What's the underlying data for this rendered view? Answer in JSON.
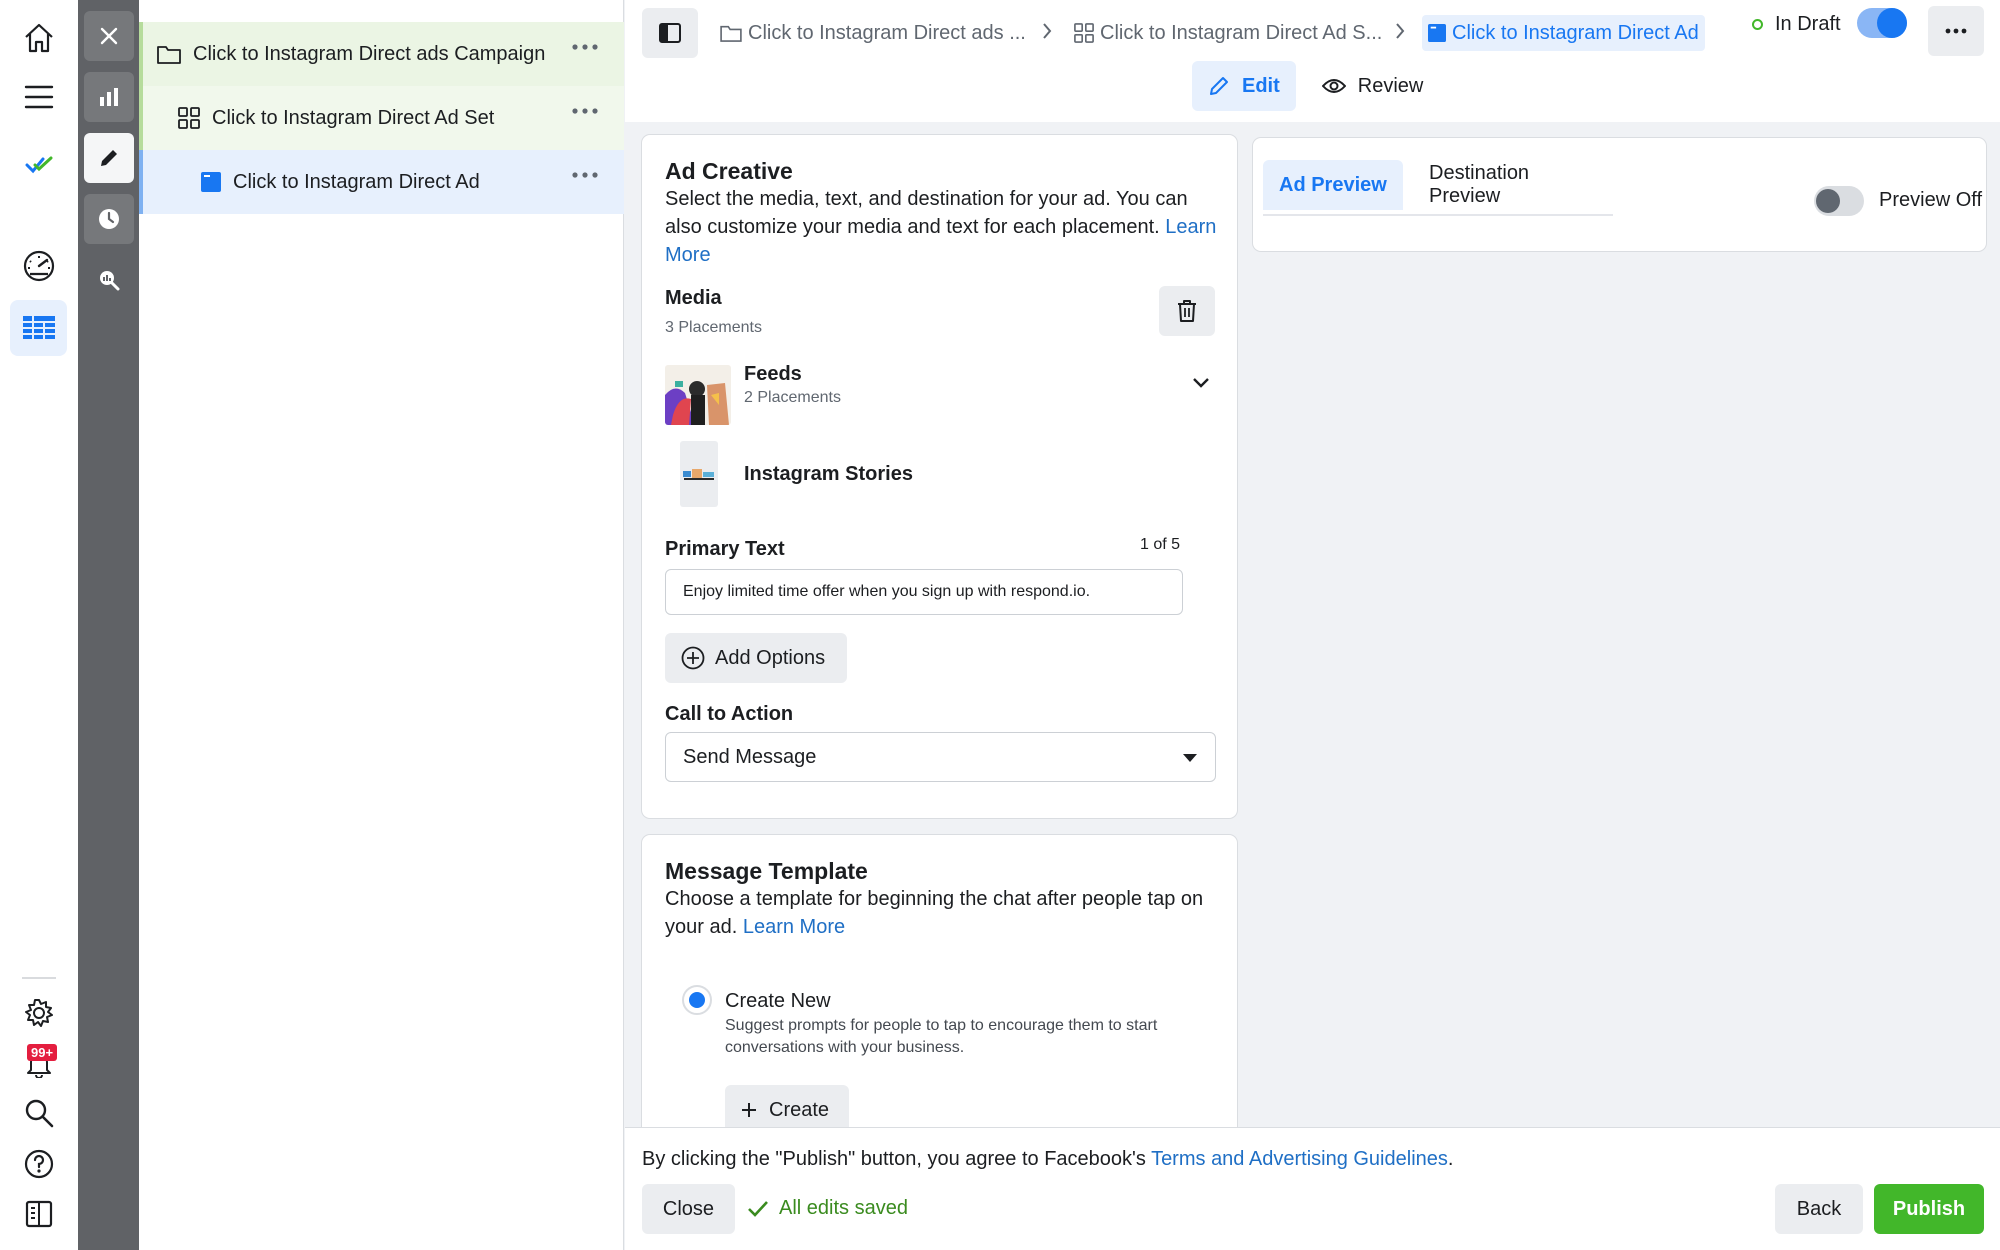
{
  "rail": {
    "notifications_badge": "99+"
  },
  "tree": {
    "campaign_label": "Click to Instagram Direct ads Campaign",
    "adset_label": "Click to Instagram Direct Ad Set",
    "ad_label": "Click to Instagram Direct Ad"
  },
  "topbar": {
    "breadcrumb": {
      "campaign": "Click to Instagram Direct ads ...",
      "adset": "Click to Instagram Direct Ad S...",
      "ad": "Click to Instagram Direct Ad"
    },
    "status": "In Draft",
    "status_toggle_on": true,
    "tabs": {
      "edit": "Edit",
      "review": "Review"
    }
  },
  "ad_creative": {
    "title": "Ad Creative",
    "description": "Select the media, text, and destination for your ad. You can also customize your media and text for each placement.",
    "learn_more": "Learn More",
    "media": {
      "title": "Media",
      "placements": "3 Placements",
      "feeds_title": "Feeds",
      "feeds_placements": "2 Placements",
      "stories_title": "Instagram Stories"
    },
    "primary_text": {
      "label": "Primary Text",
      "count": "1 of 5",
      "value": "Enjoy limited time offer when you sign up with respond.io."
    },
    "add_options": "Add Options",
    "cta": {
      "label": "Call to Action",
      "value": "Send Message"
    }
  },
  "message_template": {
    "title": "Message Template",
    "description": "Choose a template for beginning the chat after people tap on your ad.",
    "learn_more": "Learn More",
    "create_new_title": "Create New",
    "create_new_desc": "Suggest prompts for people to tap to encourage them to start conversations with your business.",
    "create_button": "Create"
  },
  "preview": {
    "tab_ad": "Ad Preview",
    "tab_destination": "Destination Preview",
    "toggle_label": "Preview Off",
    "toggle_on": false
  },
  "footer": {
    "agree_text": "By clicking the \"Publish\" button, you agree to Facebook's",
    "terms_link": "Terms and Advertising Guidelines",
    "agree_end": ".",
    "close": "Close",
    "saved": "All edits saved",
    "back": "Back",
    "publish": "Publish"
  },
  "colors": {
    "accent": "#1877f2",
    "publish": "#42b72a",
    "campaign_row": "#ebf5e4"
  }
}
